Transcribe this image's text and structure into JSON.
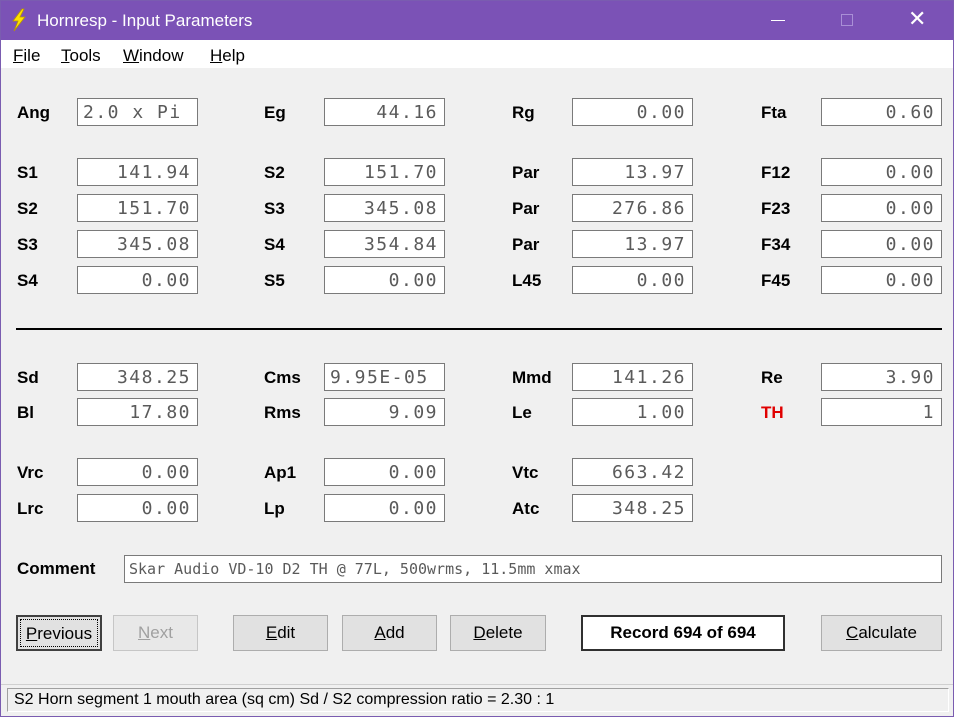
{
  "window": {
    "title": "Hornresp - Input Parameters",
    "accent_color": "#7b52b6",
    "icon": "lightning-bolt-icon"
  },
  "menu": {
    "file": {
      "acc": "F",
      "rest": "ile"
    },
    "tools": {
      "acc": "T",
      "rest": "ools"
    },
    "window": {
      "acc": "W",
      "rest": "indow"
    },
    "help": {
      "acc": "H",
      "rest": "elp"
    }
  },
  "params": {
    "ang": {
      "label": "Ang",
      "value": "2.0 x Pi"
    },
    "eg": {
      "label": "Eg",
      "value": "44.16"
    },
    "rg": {
      "label": "Rg",
      "value": "0.00"
    },
    "fta": {
      "label": "Fta",
      "value": "0.60"
    },
    "r1c1": {
      "label": "S1",
      "value": "141.94"
    },
    "r1c2": {
      "label": "S2",
      "value": "151.70"
    },
    "r1c3": {
      "label": "Par",
      "value": "13.97"
    },
    "r1c4": {
      "label": "F12",
      "value": "0.00"
    },
    "r2c1": {
      "label": "S2",
      "value": "151.70"
    },
    "r2c2": {
      "label": "S3",
      "value": "345.08"
    },
    "r2c3": {
      "label": "Par",
      "value": "276.86"
    },
    "r2c4": {
      "label": "F23",
      "value": "0.00"
    },
    "r3c1": {
      "label": "S3",
      "value": "345.08"
    },
    "r3c2": {
      "label": "S4",
      "value": "354.84"
    },
    "r3c3": {
      "label": "Par",
      "value": "13.97"
    },
    "r3c4": {
      "label": "F34",
      "value": "0.00"
    },
    "r4c1": {
      "label": "S4",
      "value": "0.00"
    },
    "r4c2": {
      "label": "S5",
      "value": "0.00"
    },
    "r4c3": {
      "label": "L45",
      "value": "0.00"
    },
    "r4c4": {
      "label": "F45",
      "value": "0.00"
    },
    "sd": {
      "label": "Sd",
      "value": "348.25"
    },
    "cms": {
      "label": "Cms",
      "value": "9.95E-05"
    },
    "mmd": {
      "label": "Mmd",
      "value": "141.26"
    },
    "re": {
      "label": "Re",
      "value": "3.90"
    },
    "bl": {
      "label": "Bl",
      "value": "17.80"
    },
    "rms": {
      "label": "Rms",
      "value": "9.09"
    },
    "le": {
      "label": "Le",
      "value": "1.00"
    },
    "th": {
      "label": "TH",
      "value": "1",
      "color": "#e00000"
    },
    "vrc": {
      "label": "Vrc",
      "value": "0.00"
    },
    "ap1": {
      "label": "Ap1",
      "value": "0.00"
    },
    "vtc": {
      "label": "Vtc",
      "value": "663.42"
    },
    "lrc": {
      "label": "Lrc",
      "value": "0.00"
    },
    "lp": {
      "label": "Lp",
      "value": "0.00"
    },
    "atc": {
      "label": "Atc",
      "value": "348.25"
    }
  },
  "comment": {
    "label": "Comment",
    "value": "Skar Audio VD-10 D2 TH @ 77L, 500wrms, 11.5mm xmax"
  },
  "buttons": {
    "previous": {
      "acc": "P",
      "rest": "revious"
    },
    "next": {
      "acc": "N",
      "rest": "ext"
    },
    "edit": {
      "acc": "E",
      "rest": "dit"
    },
    "add": {
      "acc": "A",
      "rest": "dd"
    },
    "delete": {
      "acc": "D",
      "rest": "elete"
    },
    "calculate": {
      "acc": "C",
      "rest": "alculate"
    }
  },
  "record": "Record 694 of 694",
  "status": "S2   Horn segment 1 mouth area  (sq cm)   Sd / S2 compression ratio = 2.30 : 1"
}
